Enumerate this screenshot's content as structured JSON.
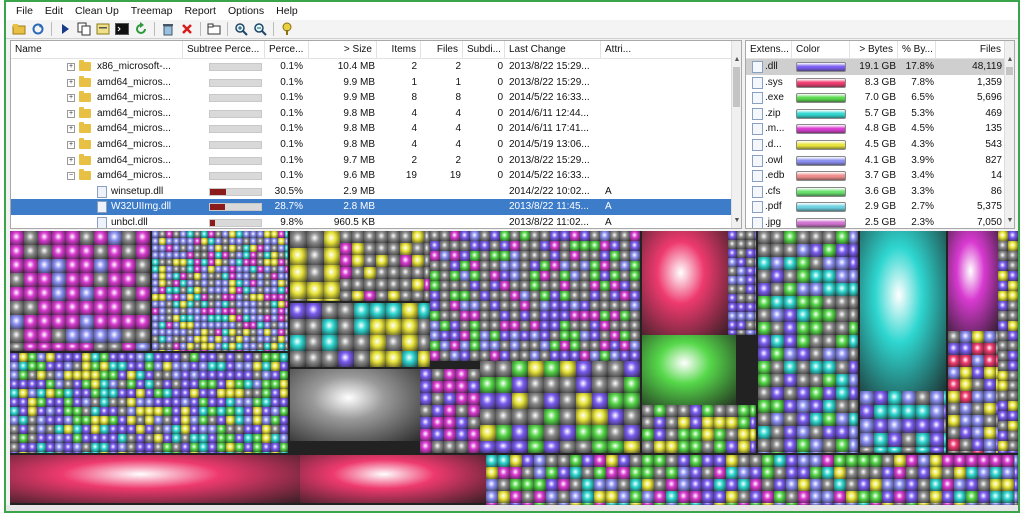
{
  "menu": [
    "File",
    "Edit",
    "Clean Up",
    "Treemap",
    "Report",
    "Options",
    "Help"
  ],
  "toolbar_icons": [
    "open-folder-icon",
    "refresh-icon",
    "play-icon",
    "copy-icon",
    "copy-path-icon",
    "terminal-icon",
    "reload-icon",
    "recycle-icon",
    "delete-icon",
    "folder-icon",
    "zoom-in-icon",
    "zoom-out-icon",
    "help-icon"
  ],
  "tree": {
    "headers": [
      "Name",
      "Subtree Perce...",
      "Perce...",
      "> Size",
      "Items",
      "Files",
      "Subdi...",
      "Last Change",
      "Attri..."
    ],
    "rows": [
      {
        "name": "x86_microsoft-...",
        "type": "folder",
        "bar": 0.0,
        "pct": "0.1%",
        "size": "10.4 MB",
        "items": "2",
        "files": "2",
        "subdirs": "0",
        "last": "2013/8/22  15:29...",
        "attr": ""
      },
      {
        "name": "amd64_micros...",
        "type": "folder",
        "bar": 0.0,
        "pct": "0.1%",
        "size": "9.9 MB",
        "items": "1",
        "files": "1",
        "subdirs": "0",
        "last": "2013/8/22  15:29...",
        "attr": ""
      },
      {
        "name": "amd64_micros...",
        "type": "folder",
        "bar": 0.0,
        "pct": "0.1%",
        "size": "9.9 MB",
        "items": "8",
        "files": "8",
        "subdirs": "0",
        "last": "2014/5/22  16:33...",
        "attr": ""
      },
      {
        "name": "amd64_micros...",
        "type": "folder",
        "bar": 0.0,
        "pct": "0.1%",
        "size": "9.8 MB",
        "items": "4",
        "files": "4",
        "subdirs": "0",
        "last": "2014/6/11  12:44...",
        "attr": ""
      },
      {
        "name": "amd64_micros...",
        "type": "folder",
        "bar": 0.0,
        "pct": "0.1%",
        "size": "9.8 MB",
        "items": "4",
        "files": "4",
        "subdirs": "0",
        "last": "2014/6/11  17:41...",
        "attr": ""
      },
      {
        "name": "amd64_micros...",
        "type": "folder",
        "bar": 0.0,
        "pct": "0.1%",
        "size": "9.8 MB",
        "items": "4",
        "files": "4",
        "subdirs": "0",
        "last": "2014/5/19  13:06...",
        "attr": ""
      },
      {
        "name": "amd64_micros...",
        "type": "folder",
        "bar": 0.0,
        "pct": "0.1%",
        "size": "9.7 MB",
        "items": "2",
        "files": "2",
        "subdirs": "0",
        "last": "2013/8/22  15:29...",
        "attr": ""
      },
      {
        "name": "amd64_micros...",
        "type": "folder",
        "bar": 0.0,
        "pct": "0.1%",
        "size": "9.6 MB",
        "items": "19",
        "files": "19",
        "subdirs": "0",
        "last": "2014/5/22  16:33...",
        "attr": "",
        "expanded": true
      },
      {
        "name": "winsetup.dll",
        "type": "file",
        "bar": 0.305,
        "pct": "30.5%",
        "size": "2.9 MB",
        "items": "",
        "files": "",
        "subdirs": "",
        "last": "2014/2/22  10:02...",
        "attr": "A"
      },
      {
        "name": "W32UIImg.dll",
        "type": "file",
        "bar": 0.287,
        "pct": "28.7%",
        "size": "2.8 MB",
        "items": "",
        "files": "",
        "subdirs": "",
        "last": "2013/8/22  11:45...",
        "attr": "A",
        "selected": true
      },
      {
        "name": "unbcl.dll",
        "type": "file",
        "bar": 0.098,
        "pct": "9.8%",
        "size": "960.5 KB",
        "items": "",
        "files": "",
        "subdirs": "",
        "last": "2013/8/22  11:02...",
        "attr": "A"
      }
    ]
  },
  "extensions": {
    "headers": [
      "Extens...",
      "Color",
      "> Bytes",
      "% By...",
      "Files"
    ],
    "rows": [
      {
        "ext": ".dll",
        "color": "#7a5cf0",
        "bytes": "19.1 GB",
        "pct": "17.8%",
        "files": "48,119",
        "selected": true
      },
      {
        "ext": ".sys",
        "color": "#ee3a6e",
        "bytes": "8.3 GB",
        "pct": "7.8%",
        "files": "1,359"
      },
      {
        "ext": ".exe",
        "color": "#56d84a",
        "bytes": "7.0 GB",
        "pct": "6.5%",
        "files": "5,696"
      },
      {
        "ext": ".zip",
        "color": "#2fd6d0",
        "bytes": "5.7 GB",
        "pct": "5.3%",
        "files": "469"
      },
      {
        "ext": ".m...",
        "color": "#d83ad0",
        "bytes": "4.8 GB",
        "pct": "4.5%",
        "files": "135"
      },
      {
        "ext": ".d...",
        "color": "#e8e43a",
        "bytes": "4.5 GB",
        "pct": "4.3%",
        "files": "543"
      },
      {
        "ext": ".owl",
        "color": "#8a8ef0",
        "bytes": "4.1 GB",
        "pct": "3.9%",
        "files": "827"
      },
      {
        "ext": ".edb",
        "color": "#f08a8a",
        "bytes": "3.7 GB",
        "pct": "3.4%",
        "files": "14"
      },
      {
        "ext": ".cfs",
        "color": "#66e06a",
        "bytes": "3.6 GB",
        "pct": "3.3%",
        "files": "86"
      },
      {
        "ext": ".pdf",
        "color": "#6ad0e0",
        "bytes": "2.9 GB",
        "pct": "2.7%",
        "files": "5,375"
      },
      {
        "ext": ".jpg",
        "color": "#d070d0",
        "bytes": "2.5 GB",
        "pct": "2.3%",
        "files": "7,050"
      }
    ]
  },
  "colors": {
    "selection": "#3d7cc9",
    "window_border": "#3aa44a",
    "percent_bar": "#8b1a1a"
  }
}
